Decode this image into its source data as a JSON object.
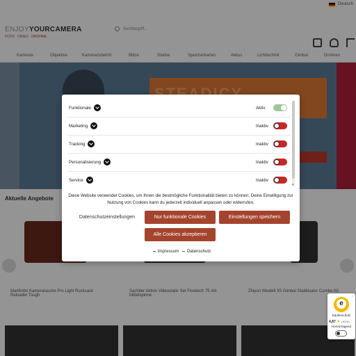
{
  "shop": {
    "lang_label": "Deutsch",
    "logo_light": "ENJOY",
    "logo_bold": "YOURCAMERA",
    "logo_sub": "FOTO · VIDEO · DROHNE",
    "search_placeholder": "Suchbegriff...",
    "nav": [
      "Kameras",
      "Objektive",
      "Kamerazubehör",
      "Blitze",
      "Stative",
      "Speicherkarten",
      "Akkus",
      "Lichttechnik",
      "Gimbal",
      "Drohnen"
    ],
    "hero_text": "STEADICY",
    "section_title": "Aktuelle Angebote",
    "cards": [
      {
        "title": "Manfrotto Kameratasche Pro Light Rucksack Reloader Tough"
      },
      {
        "title": "Sachtler Aktion Videostativ Set Flowtech 75 mit Mittelspinne"
      },
      {
        "title": "Zhiyun Weebill 3S Gimbal Stabilisator Combo Kit"
      }
    ]
  },
  "consent": {
    "categories": [
      {
        "label": "Funktionale",
        "status": "Aktiv",
        "enabled": true
      },
      {
        "label": "Marketing",
        "status": "Inaktiv",
        "enabled": false
      },
      {
        "label": "Tracking",
        "status": "Inaktiv",
        "enabled": false
      },
      {
        "label": "Personalisierung",
        "status": "Inaktiv",
        "enabled": false
      },
      {
        "label": "Service",
        "status": "Inaktiv",
        "enabled": false
      }
    ],
    "notice": "Diese Website verwendet Cookies, um Ihnen die bestmögliche Funktionalität bieten zu können. Deine Einwilligung zur Nutzung von Cookies kann du jederzeit individuell anpassen oder widerrufen.",
    "buttons": {
      "privacy_settings": "Datenschutzeinstellungen",
      "functional_only": "Nur funktionale Cookies",
      "save_settings": "Einstellungen speichern",
      "accept_all": "Alle Cookies akzeptieren"
    },
    "links": {
      "imprint": "Impressum",
      "privacy": "Datenschutz"
    }
  },
  "trust_badge": {
    "label": "Käuferschutz",
    "score": "4,87",
    "count": "(3076)",
    "rating": "Hervorragend"
  },
  "colors": {
    "accent": "#a5442e",
    "toggle_on": "#9bc79a",
    "toggle_off": "#c62828"
  }
}
